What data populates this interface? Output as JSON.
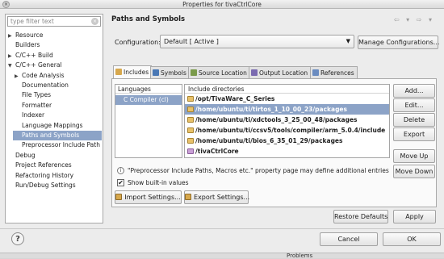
{
  "window": {
    "title": "Properties for tivaCtrlCore",
    "close_glyph": "×"
  },
  "left_pane": {
    "filter_placeholder": "type filter text",
    "items": [
      {
        "label": "Resource",
        "arrow": "▶"
      },
      {
        "label": "Builders",
        "arrow": ""
      },
      {
        "label": "C/C++ Build",
        "arrow": "▶"
      },
      {
        "label": "C/C++ General",
        "arrow": "▼"
      },
      {
        "label": "Code Analysis",
        "arrow": "▶"
      },
      {
        "label": "Documentation",
        "arrow": ""
      },
      {
        "label": "File Types",
        "arrow": ""
      },
      {
        "label": "Formatter",
        "arrow": ""
      },
      {
        "label": "Indexer",
        "arrow": ""
      },
      {
        "label": "Language Mappings",
        "arrow": ""
      },
      {
        "label": "Paths and Symbols",
        "arrow": "",
        "selected": true
      },
      {
        "label": "Preprocessor Include Path",
        "arrow": ""
      },
      {
        "label": "Debug",
        "arrow": ""
      },
      {
        "label": "Project References",
        "arrow": ""
      },
      {
        "label": "Refactoring History",
        "arrow": ""
      },
      {
        "label": "Run/Debug Settings",
        "arrow": ""
      }
    ]
  },
  "page": {
    "title": "Paths and Symbols",
    "nav_glyphs": "⇦ ▾ ⇨ ▾",
    "configuration_label": "Configuration:",
    "configuration_value": "Default  [ Active ]",
    "manage_button": "Manage Configurations...",
    "tabs": [
      {
        "label": "Includes",
        "icon_color": "#d7a84d",
        "active": true
      },
      {
        "label": "Symbols",
        "icon_color": "#4a78b5"
      },
      {
        "label": "Source Location",
        "icon_color": "#7a9a4a"
      },
      {
        "label": "Output Location",
        "icon_color": "#7a6ab0"
      },
      {
        "label": "References",
        "icon_color": "#6b8cc0"
      }
    ],
    "languages_header": "Languages",
    "languages": [
      "C Compiler (cl)"
    ],
    "includes_header": "Include directories",
    "includes": [
      {
        "path": "/opt/TivaWare_C_Series",
        "selected": false
      },
      {
        "path": "/home/ubuntu/ti/tirtos_1_10_00_23/packages",
        "selected": true
      },
      {
        "path": "/home/ubuntu/ti/xdctools_3_25_00_48/packages",
        "selected": false
      },
      {
        "path": "/home/ubuntu/ti/ccsv5/tools/compiler/arm_5.0.4/include",
        "selected": false
      },
      {
        "path": "/home/ubuntu/ti/bios_6_35_01_29/packages",
        "selected": false
      },
      {
        "path": "/tivaCtrlCore",
        "selected": false,
        "project": true
      }
    ],
    "side_buttons": {
      "add": "Add...",
      "edit": "Edit...",
      "delete": "Delete",
      "export": "Export",
      "move_up": "Move Up",
      "move_down": "Move Down"
    },
    "info_text": "\"Preprocessor Include Paths, Macros etc.\" property page may define additional entries",
    "show_builtin_label": "Show built-in values",
    "show_builtin_checked": "✔",
    "import_button": "Import Settings...",
    "export_settings_button": "Export Settings...",
    "restore_button": "Restore Defaults",
    "apply_button": "Apply"
  },
  "footer": {
    "help_glyph": "?",
    "cancel_button": "Cancel",
    "ok_button": "OK",
    "problems_tab": "Problems"
  }
}
